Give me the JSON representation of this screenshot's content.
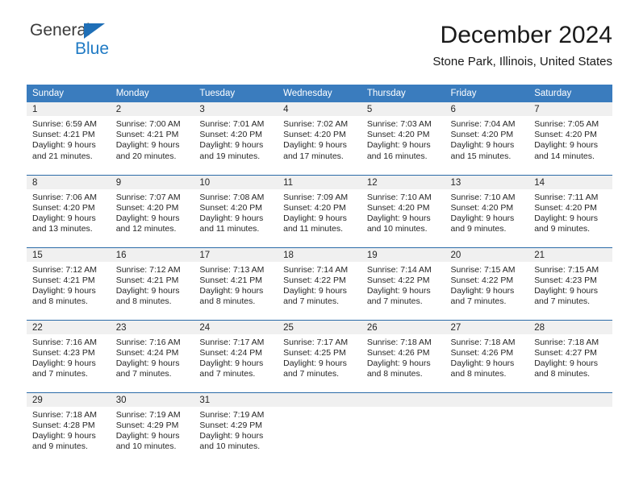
{
  "brand": {
    "name_top": "General",
    "name_bottom": "Blue",
    "accent_color": "#1f7ac4",
    "header_color": "#3a7cbe"
  },
  "header": {
    "month_title": "December 2024",
    "location": "Stone Park, Illinois, United States"
  },
  "weekday_headers": [
    "Sunday",
    "Monday",
    "Tuesday",
    "Wednesday",
    "Thursday",
    "Friday",
    "Saturday"
  ],
  "weeks": [
    [
      {
        "day": "1",
        "sunrise": "Sunrise: 6:59 AM",
        "sunset": "Sunset: 4:21 PM",
        "daylight_1": "Daylight: 9 hours",
        "daylight_2": "and 21 minutes."
      },
      {
        "day": "2",
        "sunrise": "Sunrise: 7:00 AM",
        "sunset": "Sunset: 4:21 PM",
        "daylight_1": "Daylight: 9 hours",
        "daylight_2": "and 20 minutes."
      },
      {
        "day": "3",
        "sunrise": "Sunrise: 7:01 AM",
        "sunset": "Sunset: 4:20 PM",
        "daylight_1": "Daylight: 9 hours",
        "daylight_2": "and 19 minutes."
      },
      {
        "day": "4",
        "sunrise": "Sunrise: 7:02 AM",
        "sunset": "Sunset: 4:20 PM",
        "daylight_1": "Daylight: 9 hours",
        "daylight_2": "and 17 minutes."
      },
      {
        "day": "5",
        "sunrise": "Sunrise: 7:03 AM",
        "sunset": "Sunset: 4:20 PM",
        "daylight_1": "Daylight: 9 hours",
        "daylight_2": "and 16 minutes."
      },
      {
        "day": "6",
        "sunrise": "Sunrise: 7:04 AM",
        "sunset": "Sunset: 4:20 PM",
        "daylight_1": "Daylight: 9 hours",
        "daylight_2": "and 15 minutes."
      },
      {
        "day": "7",
        "sunrise": "Sunrise: 7:05 AM",
        "sunset": "Sunset: 4:20 PM",
        "daylight_1": "Daylight: 9 hours",
        "daylight_2": "and 14 minutes."
      }
    ],
    [
      {
        "day": "8",
        "sunrise": "Sunrise: 7:06 AM",
        "sunset": "Sunset: 4:20 PM",
        "daylight_1": "Daylight: 9 hours",
        "daylight_2": "and 13 minutes."
      },
      {
        "day": "9",
        "sunrise": "Sunrise: 7:07 AM",
        "sunset": "Sunset: 4:20 PM",
        "daylight_1": "Daylight: 9 hours",
        "daylight_2": "and 12 minutes."
      },
      {
        "day": "10",
        "sunrise": "Sunrise: 7:08 AM",
        "sunset": "Sunset: 4:20 PM",
        "daylight_1": "Daylight: 9 hours",
        "daylight_2": "and 11 minutes."
      },
      {
        "day": "11",
        "sunrise": "Sunrise: 7:09 AM",
        "sunset": "Sunset: 4:20 PM",
        "daylight_1": "Daylight: 9 hours",
        "daylight_2": "and 11 minutes."
      },
      {
        "day": "12",
        "sunrise": "Sunrise: 7:10 AM",
        "sunset": "Sunset: 4:20 PM",
        "daylight_1": "Daylight: 9 hours",
        "daylight_2": "and 10 minutes."
      },
      {
        "day": "13",
        "sunrise": "Sunrise: 7:10 AM",
        "sunset": "Sunset: 4:20 PM",
        "daylight_1": "Daylight: 9 hours",
        "daylight_2": "and 9 minutes."
      },
      {
        "day": "14",
        "sunrise": "Sunrise: 7:11 AM",
        "sunset": "Sunset: 4:20 PM",
        "daylight_1": "Daylight: 9 hours",
        "daylight_2": "and 9 minutes."
      }
    ],
    [
      {
        "day": "15",
        "sunrise": "Sunrise: 7:12 AM",
        "sunset": "Sunset: 4:21 PM",
        "daylight_1": "Daylight: 9 hours",
        "daylight_2": "and 8 minutes."
      },
      {
        "day": "16",
        "sunrise": "Sunrise: 7:12 AM",
        "sunset": "Sunset: 4:21 PM",
        "daylight_1": "Daylight: 9 hours",
        "daylight_2": "and 8 minutes."
      },
      {
        "day": "17",
        "sunrise": "Sunrise: 7:13 AM",
        "sunset": "Sunset: 4:21 PM",
        "daylight_1": "Daylight: 9 hours",
        "daylight_2": "and 8 minutes."
      },
      {
        "day": "18",
        "sunrise": "Sunrise: 7:14 AM",
        "sunset": "Sunset: 4:22 PM",
        "daylight_1": "Daylight: 9 hours",
        "daylight_2": "and 7 minutes."
      },
      {
        "day": "19",
        "sunrise": "Sunrise: 7:14 AM",
        "sunset": "Sunset: 4:22 PM",
        "daylight_1": "Daylight: 9 hours",
        "daylight_2": "and 7 minutes."
      },
      {
        "day": "20",
        "sunrise": "Sunrise: 7:15 AM",
        "sunset": "Sunset: 4:22 PM",
        "daylight_1": "Daylight: 9 hours",
        "daylight_2": "and 7 minutes."
      },
      {
        "day": "21",
        "sunrise": "Sunrise: 7:15 AM",
        "sunset": "Sunset: 4:23 PM",
        "daylight_1": "Daylight: 9 hours",
        "daylight_2": "and 7 minutes."
      }
    ],
    [
      {
        "day": "22",
        "sunrise": "Sunrise: 7:16 AM",
        "sunset": "Sunset: 4:23 PM",
        "daylight_1": "Daylight: 9 hours",
        "daylight_2": "and 7 minutes."
      },
      {
        "day": "23",
        "sunrise": "Sunrise: 7:16 AM",
        "sunset": "Sunset: 4:24 PM",
        "daylight_1": "Daylight: 9 hours",
        "daylight_2": "and 7 minutes."
      },
      {
        "day": "24",
        "sunrise": "Sunrise: 7:17 AM",
        "sunset": "Sunset: 4:24 PM",
        "daylight_1": "Daylight: 9 hours",
        "daylight_2": "and 7 minutes."
      },
      {
        "day": "25",
        "sunrise": "Sunrise: 7:17 AM",
        "sunset": "Sunset: 4:25 PM",
        "daylight_1": "Daylight: 9 hours",
        "daylight_2": "and 7 minutes."
      },
      {
        "day": "26",
        "sunrise": "Sunrise: 7:18 AM",
        "sunset": "Sunset: 4:26 PM",
        "daylight_1": "Daylight: 9 hours",
        "daylight_2": "and 8 minutes."
      },
      {
        "day": "27",
        "sunrise": "Sunrise: 7:18 AM",
        "sunset": "Sunset: 4:26 PM",
        "daylight_1": "Daylight: 9 hours",
        "daylight_2": "and 8 minutes."
      },
      {
        "day": "28",
        "sunrise": "Sunrise: 7:18 AM",
        "sunset": "Sunset: 4:27 PM",
        "daylight_1": "Daylight: 9 hours",
        "daylight_2": "and 8 minutes."
      }
    ],
    [
      {
        "day": "29",
        "sunrise": "Sunrise: 7:18 AM",
        "sunset": "Sunset: 4:28 PM",
        "daylight_1": "Daylight: 9 hours",
        "daylight_2": "and 9 minutes."
      },
      {
        "day": "30",
        "sunrise": "Sunrise: 7:19 AM",
        "sunset": "Sunset: 4:29 PM",
        "daylight_1": "Daylight: 9 hours",
        "daylight_2": "and 10 minutes."
      },
      {
        "day": "31",
        "sunrise": "Sunrise: 7:19 AM",
        "sunset": "Sunset: 4:29 PM",
        "daylight_1": "Daylight: 9 hours",
        "daylight_2": "and 10 minutes."
      },
      {
        "day": "",
        "sunrise": "",
        "sunset": "",
        "daylight_1": "",
        "daylight_2": ""
      },
      {
        "day": "",
        "sunrise": "",
        "sunset": "",
        "daylight_1": "",
        "daylight_2": ""
      },
      {
        "day": "",
        "sunrise": "",
        "sunset": "",
        "daylight_1": "",
        "daylight_2": ""
      },
      {
        "day": "",
        "sunrise": "",
        "sunset": "",
        "daylight_1": "",
        "daylight_2": ""
      }
    ]
  ]
}
